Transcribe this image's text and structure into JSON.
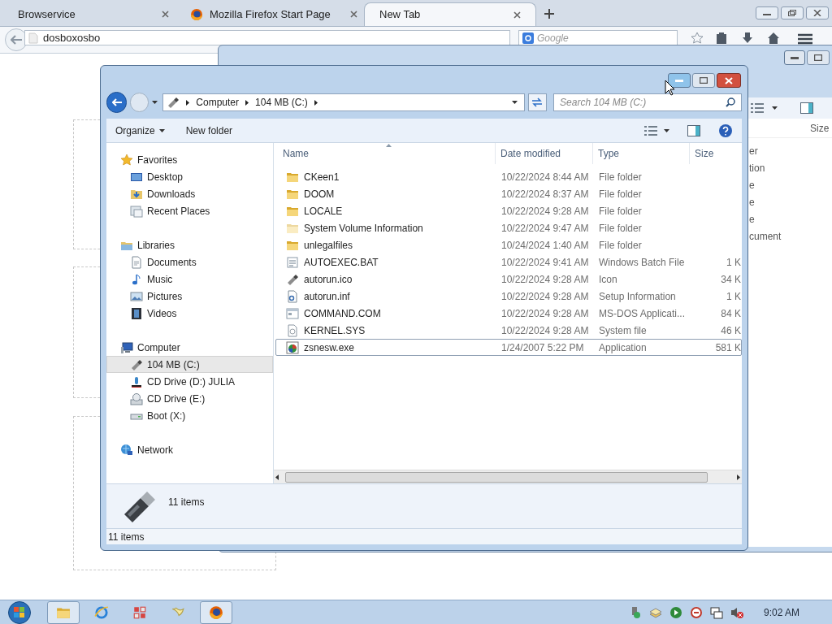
{
  "browser": {
    "tabs": [
      {
        "label": "Browservice",
        "kind": "plain",
        "selected": false
      },
      {
        "label": "Mozilla Firefox Start Page",
        "kind": "firefox",
        "selected": false
      },
      {
        "label": "New Tab",
        "kind": "plain",
        "selected": true
      }
    ],
    "address": "dosboxosbo",
    "search_placeholder": "Google"
  },
  "background_window": {
    "column": "Size",
    "fragments": [
      "er",
      "tion",
      "e",
      "e",
      "e",
      "cument"
    ]
  },
  "explorer": {
    "breadcrumb": [
      "Computer",
      "104 MB (C:)"
    ],
    "search_placeholder": "Search 104 MB (C:)",
    "toolbar": [
      "Organize",
      "New folder"
    ],
    "nav": [
      {
        "label": "Favorites",
        "kind": "star",
        "selected": false,
        "children": [
          {
            "label": "Desktop",
            "kind": "desktop",
            "selected": false
          },
          {
            "label": "Downloads",
            "kind": "downloads",
            "selected": false
          },
          {
            "label": "Recent Places",
            "kind": "recent",
            "selected": false
          }
        ]
      },
      {
        "label": "Libraries",
        "kind": "libraries",
        "selected": false,
        "children": [
          {
            "label": "Documents",
            "kind": "document",
            "selected": false
          },
          {
            "label": "Music",
            "kind": "music",
            "selected": false
          },
          {
            "label": "Pictures",
            "kind": "pictures",
            "selected": false
          },
          {
            "label": "Videos",
            "kind": "video",
            "selected": false
          }
        ]
      },
      {
        "label": "Computer",
        "kind": "computer",
        "selected": false,
        "children": [
          {
            "label": "104 MB (C:)",
            "kind": "usb",
            "selected": true
          },
          {
            "label": "CD Drive (D:) JULIA",
            "kind": "cd",
            "selected": false
          },
          {
            "label": "CD Drive (E:)",
            "kind": "disc",
            "selected": false
          },
          {
            "label": "Boot (X:)",
            "kind": "drive",
            "selected": false
          }
        ]
      },
      {
        "label": "Network",
        "kind": "network",
        "selected": false
      }
    ],
    "columns": [
      "Name",
      "Date modified",
      "Type",
      "Size"
    ],
    "rows": [
      {
        "name": "CKeen1",
        "date": "10/22/2024 8:44 AM",
        "type": "File folder",
        "kind": "folder",
        "selected": false
      },
      {
        "name": "DOOM",
        "date": "10/22/2024 8:37 AM",
        "type": "File folder",
        "kind": "folder",
        "selected": false
      },
      {
        "name": "LOCALE",
        "date": "10/22/2024 9:28 AM",
        "type": "File folder",
        "kind": "folder",
        "selected": false
      },
      {
        "name": "System Volume Information",
        "date": "10/22/2024 9:47 AM",
        "type": "File folder",
        "kind": "hidden-folder",
        "selected": false
      },
      {
        "name": "unlegalfiles",
        "date": "10/24/2024 1:40 AM",
        "type": "File folder",
        "kind": "folder",
        "selected": false
      },
      {
        "name": "AUTOEXEC.BAT",
        "date": "10/22/2024 9:41 AM",
        "type": "Windows Batch File",
        "size": "1 K",
        "kind": "batch",
        "selected": false
      },
      {
        "name": "autorun.ico",
        "date": "10/22/2024 9:28 AM",
        "type": "Icon",
        "size": "34 K",
        "kind": "usb",
        "selected": false
      },
      {
        "name": "autorun.inf",
        "date": "10/22/2024 9:28 AM",
        "type": "Setup Information",
        "size": "1 K",
        "kind": "inf",
        "selected": false
      },
      {
        "name": "COMMAND.COM",
        "date": "10/22/2024 9:28 AM",
        "type": "MS-DOS Applicati...",
        "size": "84 K",
        "kind": "com",
        "selected": false
      },
      {
        "name": "KERNEL.SYS",
        "date": "10/22/2024 9:28 AM",
        "type": "System file",
        "size": "46 K",
        "kind": "sys",
        "selected": false
      },
      {
        "name": "zsnesw.exe",
        "date": "1/24/2007 5:22 PM",
        "type": "Application",
        "size": "581 K",
        "kind": "exe",
        "selected": true
      }
    ],
    "details": "11 items",
    "status": "11 items"
  },
  "taskbar": {
    "apps": [
      {
        "kind": "folder",
        "active": true
      },
      {
        "kind": "ie",
        "active": false
      },
      {
        "kind": "grid",
        "active": false
      },
      {
        "kind": "bird",
        "active": false
      },
      {
        "kind": "firefox",
        "active": true
      }
    ],
    "clock": "9:02 AM"
  }
}
